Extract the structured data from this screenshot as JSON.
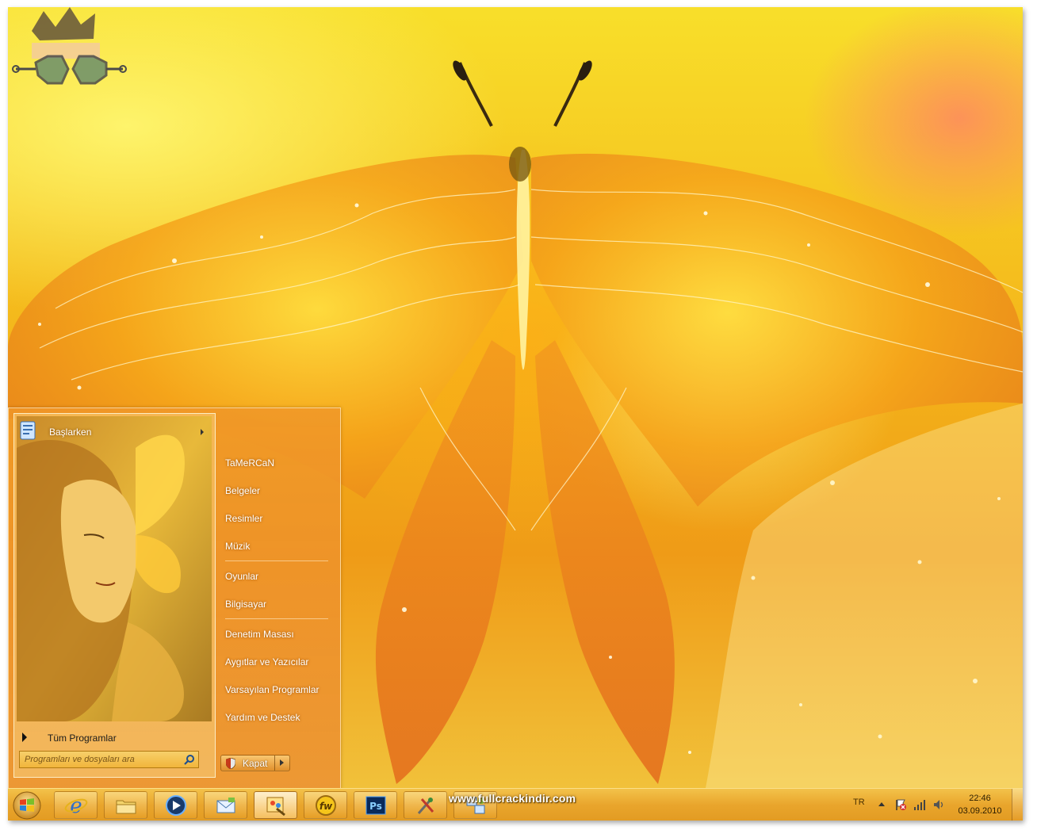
{
  "start_menu": {
    "pinned": {
      "label": "Başlarken"
    },
    "all_programs": "Tüm Programlar",
    "search": {
      "placeholder": "Programları ve dosyaları ara"
    },
    "right_items": [
      "TaMeRCaN",
      "Belgeler",
      "Resimler",
      "Müzik",
      "Oyunlar",
      "Bilgisayar",
      "Denetim Masası",
      "Aygıtlar ve Yazıcılar",
      "Varsayılan Programlar",
      "Yardım ve Destek"
    ],
    "shutdown_label": "Kapat"
  },
  "taskbar": {
    "pinned_apps": [
      {
        "name": "internet-explorer-icon"
      },
      {
        "name": "folder-icon"
      },
      {
        "name": "media-player-icon"
      },
      {
        "name": "mail-icon"
      },
      {
        "name": "theme-paint-icon",
        "active": true
      },
      {
        "name": "fw-app-icon"
      },
      {
        "name": "photoshop-icon"
      },
      {
        "name": "tools-icon"
      },
      {
        "name": "network-app-icon"
      }
    ],
    "watermark": "www.fullcrackindir.com",
    "tray": {
      "language": "TR",
      "time": "22:46",
      "date": "03.09.2010"
    }
  },
  "colors": {
    "accent": "#e9a52c",
    "wallpaper_main": "#f4b41a",
    "menu_bg": "#f09628"
  }
}
